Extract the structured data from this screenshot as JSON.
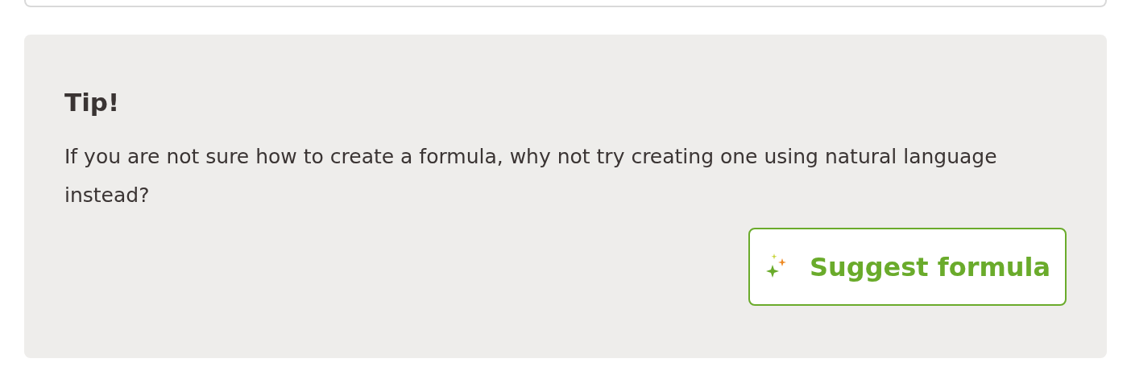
{
  "tip": {
    "title": "Tip!",
    "text": "If you are not sure how to create a formula, why not try creating one using natural language instead?",
    "button": {
      "label": "Suggest formula"
    }
  }
}
